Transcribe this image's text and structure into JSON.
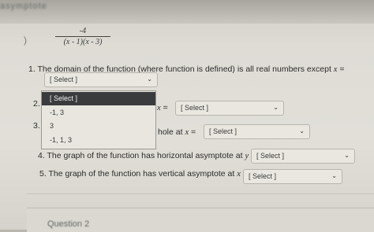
{
  "header_text": "asymptote",
  "expression": {
    "numerator": "-4",
    "denominator": "(x - 1)(x - 3)"
  },
  "questions": [
    {
      "number": "1.",
      "text": "The domain of the function (where function is defined) is all real numbers except",
      "var": "x",
      "eq": "=",
      "select": "[ Select ]"
    },
    {
      "number": "2.",
      "var": "x",
      "eq": "=",
      "select": "[ Select ]"
    },
    {
      "number": "3.",
      "text": "hole at",
      "var": "x",
      "eq": "=",
      "select": "[ Select ]"
    },
    {
      "number": "4.",
      "text": "The graph of the function has horizontal asymptote at",
      "var": "y",
      "eq": "=",
      "select": "[ Select ]"
    },
    {
      "number": "5.",
      "text": "The graph of the function has vertical asymptote at",
      "var": "x",
      "eq": "=",
      "select": "[ Select ]"
    }
  ],
  "dropdown_options": [
    "[ Select ]",
    "-1, 3",
    "3",
    "-1, 1, 3"
  ],
  "footer": {
    "label": "Question 2"
  },
  "colors": {
    "dropdown_highlight": "#3a3b3d",
    "page_bg": "#e1dfd8"
  }
}
